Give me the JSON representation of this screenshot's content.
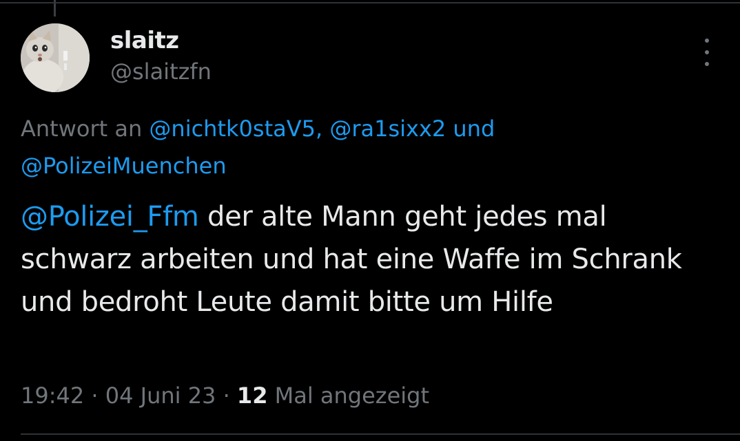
{
  "tweet": {
    "author": {
      "display_name": "slaitz",
      "handle": "@slaitzfn",
      "avatar_icon": "cat-avatar-icon"
    },
    "menu_icon": "more-options-icon",
    "reply_to": {
      "prefix": "Antwort an",
      "mentions": [
        "@nichtk0staV5,",
        "@ra1sixx2",
        "@PolizeiMuenchen"
      ],
      "conjunction": "und"
    },
    "text": {
      "mention": "@Polizei_Ffm",
      "body": " der alte Mann geht jedes mal schwarz arbeiten und hat eine Waffe im Schrank und bedroht Leute damit bitte um Hilfe"
    },
    "meta": {
      "time": "19:42",
      "separator": " · ",
      "date": "04 Juni 23",
      "views_count": "12",
      "views_label": " Mal angezeigt"
    }
  },
  "colors": {
    "background": "#000000",
    "text_primary": "#e7e9ea",
    "text_secondary": "#71767b",
    "link": "#1d9bf0",
    "divider": "#2f3336"
  }
}
